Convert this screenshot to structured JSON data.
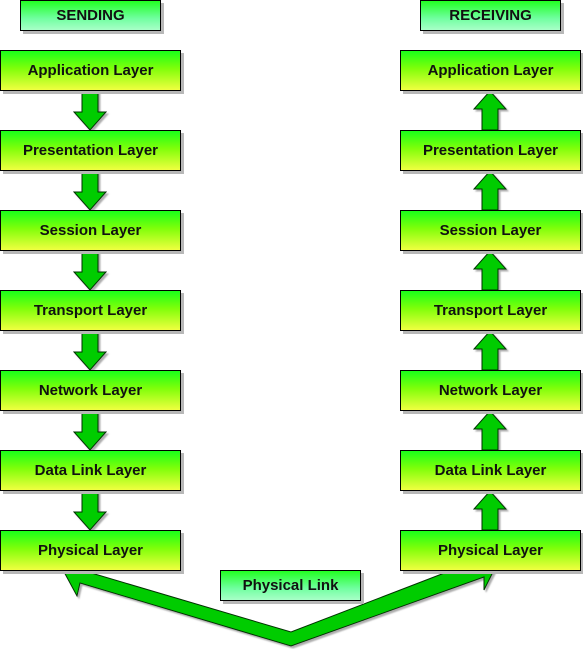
{
  "diagram": {
    "sending": {
      "title": "SENDING",
      "layers": [
        "Application Layer",
        "Presentation Layer",
        "Session Layer",
        "Transport Layer",
        "Network Layer",
        "Data Link Layer",
        "Physical Layer"
      ],
      "flow_direction": "down"
    },
    "receiving": {
      "title": "RECEIVING",
      "layers": [
        "Application Layer",
        "Presentation Layer",
        "Session Layer",
        "Transport Layer",
        "Network Layer",
        "Data Link Layer",
        "Physical Layer"
      ],
      "flow_direction": "up"
    },
    "link_label": "Physical Link",
    "colors": {
      "arrow_fill": "#00cc00",
      "arrow_stroke": "#003300",
      "layer_top": "#1aff1a",
      "layer_bottom": "#f0ff40",
      "header_top": "#22ff22",
      "header_bottom": "#a8ffc8"
    }
  }
}
